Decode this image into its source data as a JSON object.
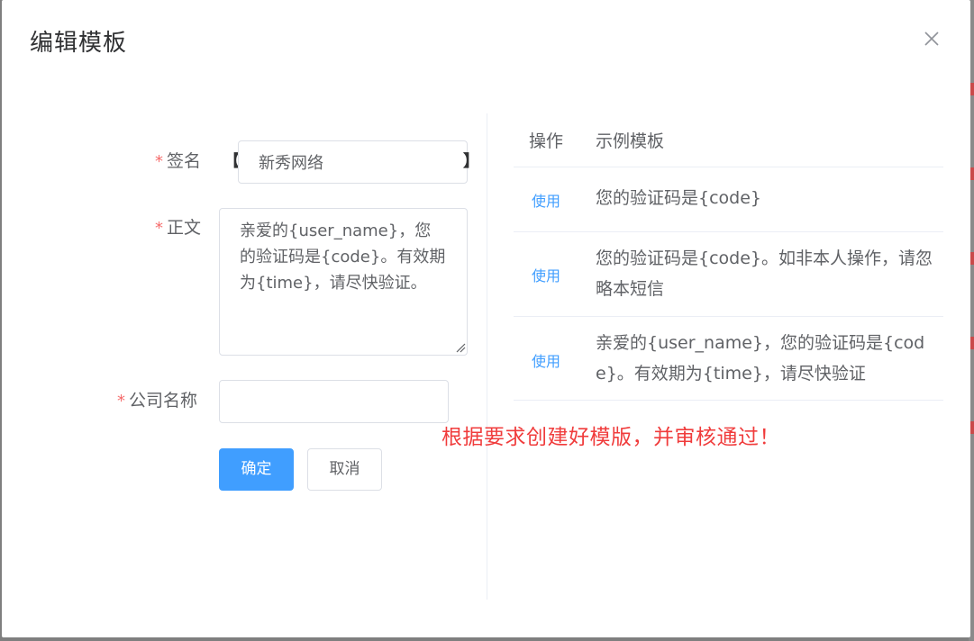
{
  "dialog": {
    "title": "编辑模板",
    "close_icon": "close-icon"
  },
  "form": {
    "required_mark": "*",
    "signature": {
      "label": "签名",
      "bracket_open": "【",
      "bracket_close": "】",
      "value": "新秀网络"
    },
    "body": {
      "label": "正文",
      "value": "亲爱的{user_name}，您的验证码是{code}。有效期为{time}，请尽快验证。"
    },
    "company": {
      "label": "公司名称",
      "value": ""
    },
    "confirm_label": "确定",
    "cancel_label": "取消"
  },
  "templates": {
    "headers": {
      "operation": "操作",
      "sample": "示例模板"
    },
    "rows": [
      {
        "action": "使用",
        "text": "您的验证码是{code}"
      },
      {
        "action": "使用",
        "text": "您的验证码是{code}。如非本人操作，请忽略本短信"
      },
      {
        "action": "使用",
        "text": "亲爱的{user_name}，您的验证码是{code}。有效期为{time}，请尽快验证"
      }
    ]
  },
  "notice": "根据要求创建好模版，并审核通过！",
  "colors": {
    "primary": "#409eff",
    "required": "#f56c6c",
    "notice": "#f03c3c"
  }
}
